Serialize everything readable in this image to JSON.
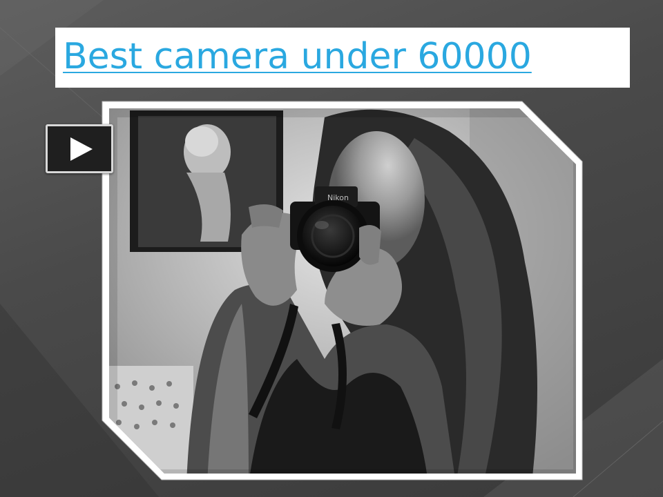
{
  "slide": {
    "title": "Best camera under 60000",
    "title_link_color": "#2aa8e0",
    "background_color": "#4a4a4a",
    "photo_alt": "Black and white photo of a woman holding a Nikon camera in front of her face",
    "camera_brand_text": "Nikon",
    "play_button_icon": "play-icon"
  }
}
